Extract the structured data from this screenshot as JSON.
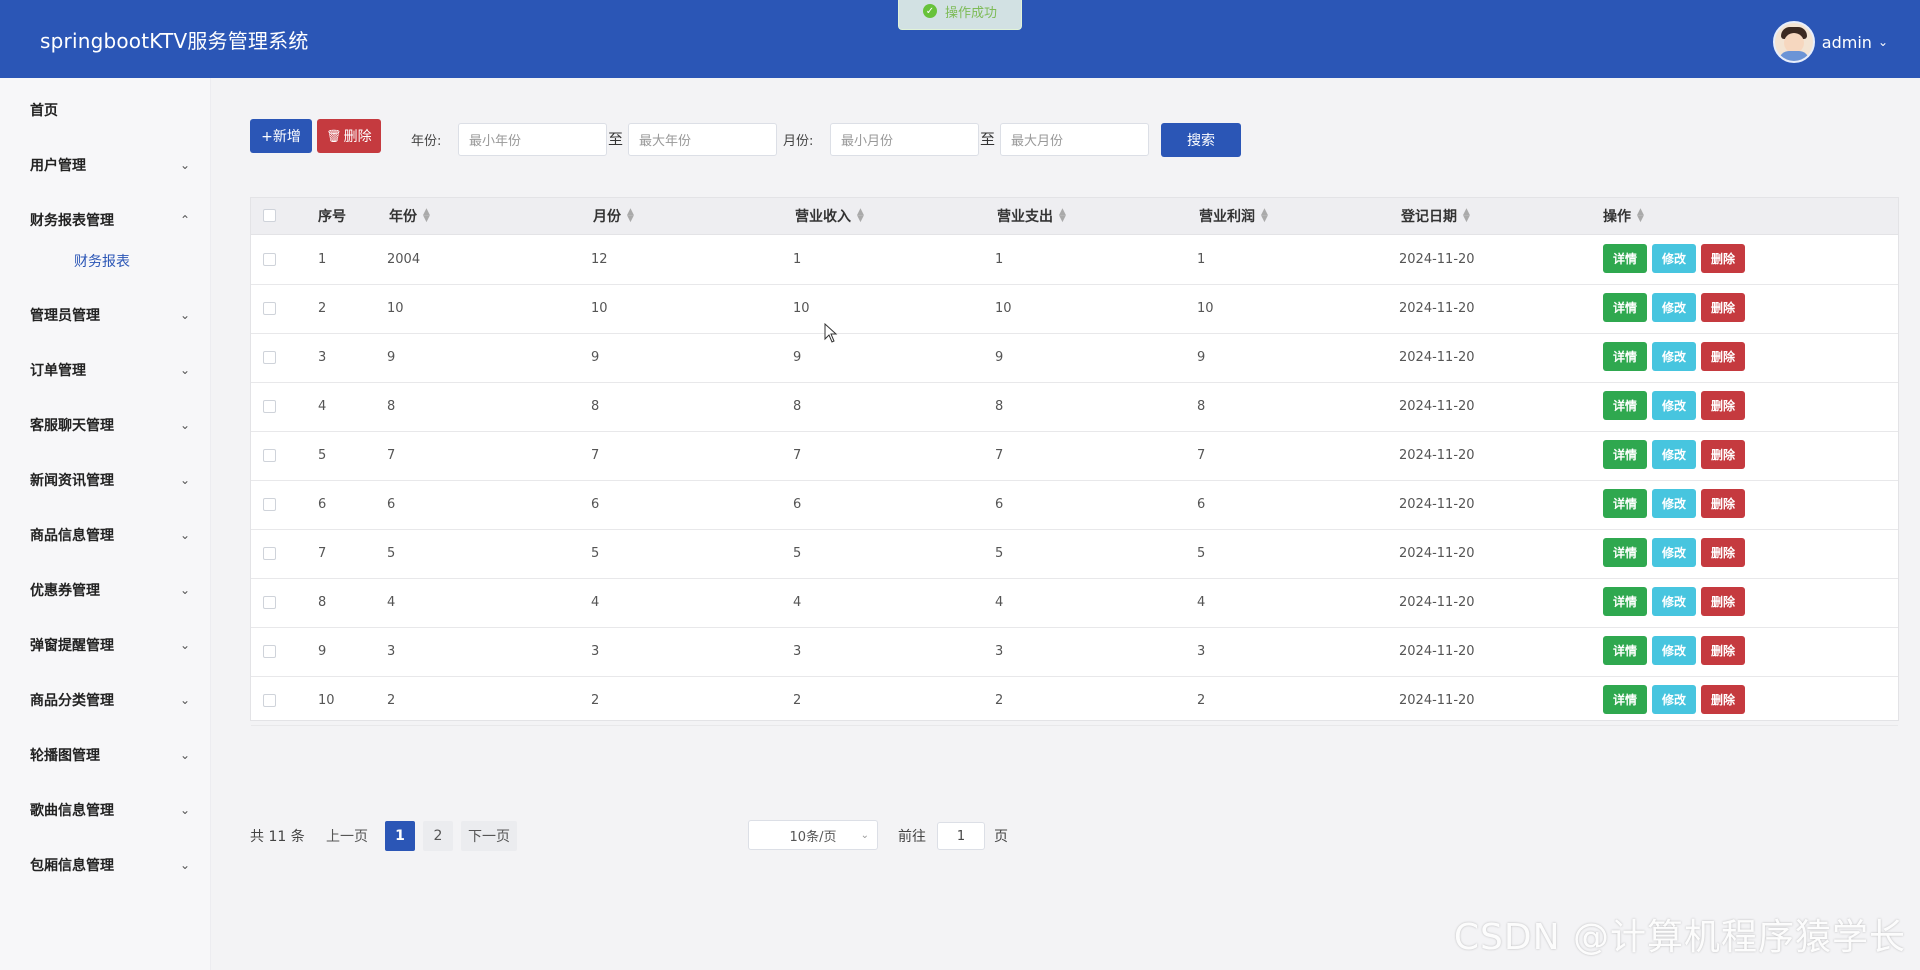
{
  "header": {
    "title": "springbootKTV服务管理系统",
    "user": "admin"
  },
  "toast": {
    "message": "操作成功"
  },
  "sidebar": {
    "items": [
      {
        "label": "首页",
        "has_arrow": false,
        "arrow": ""
      },
      {
        "label": "用户管理",
        "has_arrow": true,
        "arrow": "⌄"
      },
      {
        "label": "财务报表管理",
        "has_arrow": true,
        "arrow": "⌃"
      },
      {
        "label": "管理员管理",
        "has_arrow": true,
        "arrow": "⌄"
      },
      {
        "label": "订单管理",
        "has_arrow": true,
        "arrow": "⌄"
      },
      {
        "label": "客服聊天管理",
        "has_arrow": true,
        "arrow": "⌄"
      },
      {
        "label": "新闻资讯管理",
        "has_arrow": true,
        "arrow": "⌄"
      },
      {
        "label": "商品信息管理",
        "has_arrow": true,
        "arrow": "⌄"
      },
      {
        "label": "优惠券管理",
        "has_arrow": true,
        "arrow": "⌄"
      },
      {
        "label": "弹窗提醒管理",
        "has_arrow": true,
        "arrow": "⌄"
      },
      {
        "label": "商品分类管理",
        "has_arrow": true,
        "arrow": "⌄"
      },
      {
        "label": "轮播图管理",
        "has_arrow": true,
        "arrow": "⌄"
      },
      {
        "label": "歌曲信息管理",
        "has_arrow": true,
        "arrow": "⌄"
      },
      {
        "label": "包厢信息管理",
        "has_arrow": true,
        "arrow": "⌄"
      }
    ],
    "submenu": {
      "label": "财务报表"
    }
  },
  "toolbar": {
    "add_label": "+新增",
    "delete_label": "删除",
    "year_label": "年份:",
    "year_min_placeholder": "最小年份",
    "year_max_placeholder": "最大年份",
    "to_label": "至",
    "month_label": "月份:",
    "month_min_placeholder": "最小月份",
    "month_max_placeholder": "最大月份",
    "search_label": "搜索"
  },
  "table": {
    "headers": {
      "index": "序号",
      "year": "年份",
      "month": "月份",
      "income": "营业收入",
      "expense": "营业支出",
      "profit": "营业利润",
      "date": "登记日期",
      "action": "操作"
    },
    "action_labels": {
      "detail": "详情",
      "edit": "修改",
      "delete": "删除"
    },
    "rows": [
      {
        "index": "1",
        "year": "2004",
        "month": "12",
        "income": "1",
        "expense": "1",
        "profit": "1",
        "date": "2024-11-20"
      },
      {
        "index": "2",
        "year": "10",
        "month": "10",
        "income": "10",
        "expense": "10",
        "profit": "10",
        "date": "2024-11-20"
      },
      {
        "index": "3",
        "year": "9",
        "month": "9",
        "income": "9",
        "expense": "9",
        "profit": "9",
        "date": "2024-11-20"
      },
      {
        "index": "4",
        "year": "8",
        "month": "8",
        "income": "8",
        "expense": "8",
        "profit": "8",
        "date": "2024-11-20"
      },
      {
        "index": "5",
        "year": "7",
        "month": "7",
        "income": "7",
        "expense": "7",
        "profit": "7",
        "date": "2024-11-20"
      },
      {
        "index": "6",
        "year": "6",
        "month": "6",
        "income": "6",
        "expense": "6",
        "profit": "6",
        "date": "2024-11-20"
      },
      {
        "index": "7",
        "year": "5",
        "month": "5",
        "income": "5",
        "expense": "5",
        "profit": "5",
        "date": "2024-11-20"
      },
      {
        "index": "8",
        "year": "4",
        "month": "4",
        "income": "4",
        "expense": "4",
        "profit": "4",
        "date": "2024-11-20"
      },
      {
        "index": "9",
        "year": "3",
        "month": "3",
        "income": "3",
        "expense": "3",
        "profit": "3",
        "date": "2024-11-20"
      },
      {
        "index": "10",
        "year": "2",
        "month": "2",
        "income": "2",
        "expense": "2",
        "profit": "2",
        "date": "2024-11-20"
      }
    ]
  },
  "pagination": {
    "total": "共 11 条",
    "prev": "上一页",
    "pages": [
      "1",
      "2"
    ],
    "next": "下一页",
    "page_size": "10条/页",
    "goto_label": "前往",
    "goto_value": "1",
    "page_suffix": "页"
  },
  "watermark": "CSDN @计算机程序猿学长"
}
